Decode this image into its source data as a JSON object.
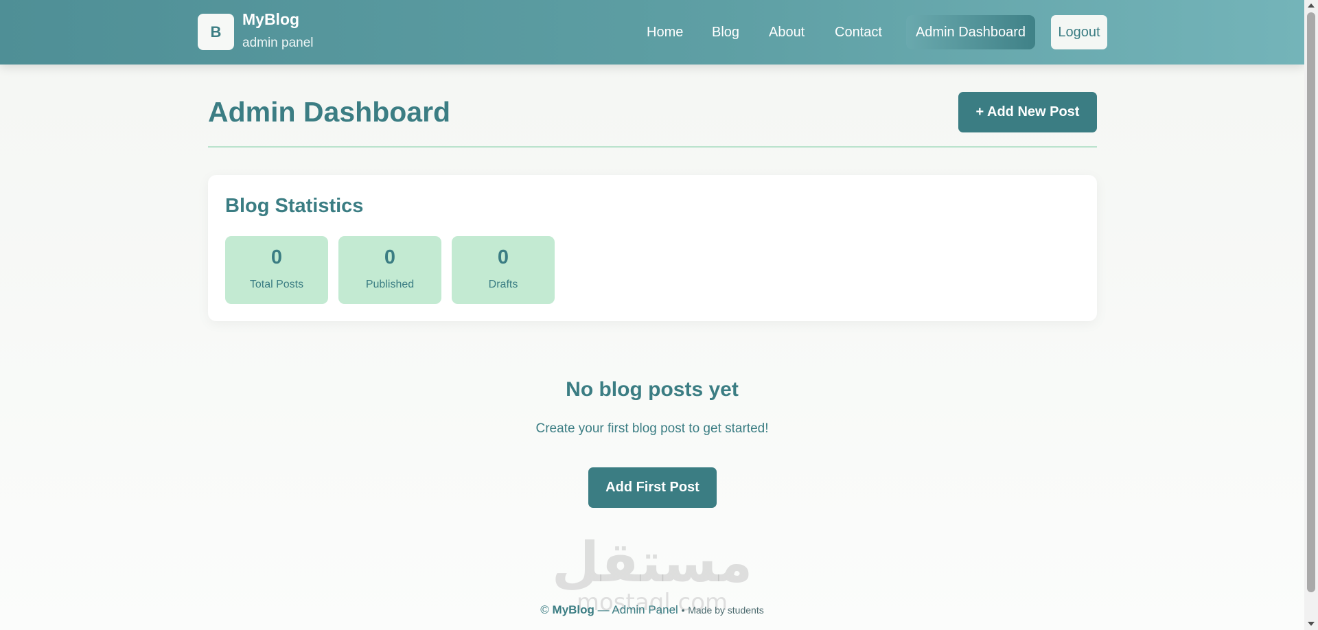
{
  "brand": {
    "logo_letter": "B",
    "name": "MyBlog",
    "subtitle": "admin panel"
  },
  "nav": {
    "home": "Home",
    "blog": "Blog",
    "about": "About",
    "contact": "Contact",
    "admin": "Admin Dashboard",
    "logout": "Logout"
  },
  "page": {
    "title": "Admin Dashboard",
    "add_new_post": "+ Add New Post"
  },
  "stats": {
    "title": "Blog Statistics",
    "items": [
      {
        "value": "0",
        "label": "Total Posts"
      },
      {
        "value": "0",
        "label": "Published"
      },
      {
        "value": "0",
        "label": "Drafts"
      }
    ]
  },
  "empty": {
    "title": "No blog posts yet",
    "text": "Create your first blog post to get started!",
    "button": "Add First Post"
  },
  "watermark": {
    "main": "مستقل",
    "sub": "mostaql.com"
  },
  "footer": {
    "copyright": "©",
    "brand": "MyBlog",
    "sep": " — Admin Panel",
    "bullet": "•",
    "note": "Made by students"
  },
  "colors": {
    "accent": "#3b7d83",
    "header_start": "#4f8f96",
    "header_end": "#74b4b9",
    "stat_bg": "#c3ead2",
    "divider": "#b9e2cc"
  }
}
